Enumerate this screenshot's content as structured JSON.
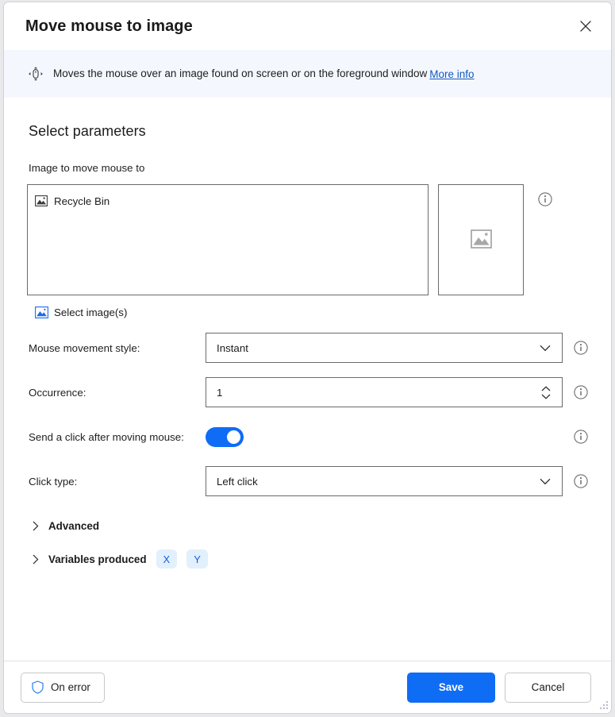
{
  "window": {
    "title": "Move mouse to image",
    "close_icon": "close-icon"
  },
  "banner": {
    "icon": "move-mouse-icon",
    "text": "Moves the mouse over an image found on screen or on the foreground window",
    "link_label": "More info"
  },
  "main": {
    "section_title": "Select parameters",
    "image_field": {
      "label": "Image to move mouse to",
      "items": [
        {
          "icon": "image-icon",
          "label": "Recycle Bin"
        }
      ],
      "thumbnail_placeholder_icon": "image-placeholder-icon",
      "info_icon": "info-icon",
      "select_link": {
        "icon": "image-icon-blue",
        "label": "Select image(s)"
      }
    },
    "params": [
      {
        "label": "Mouse movement style:",
        "type": "dropdown",
        "value": "Instant",
        "info_icon": "info-icon",
        "chevron_icon": "chevron-down-icon"
      },
      {
        "label": "Occurrence:",
        "type": "number",
        "value": "1",
        "info_icon": "info-icon",
        "spinner_icon": "spinner-arrows-icon"
      },
      {
        "label": "Send a click after moving mouse:",
        "type": "toggle",
        "value": "on",
        "info_icon": "info-icon"
      },
      {
        "label": "Click type:",
        "type": "dropdown",
        "value": "Left click",
        "info_icon": "info-icon",
        "chevron_icon": "chevron-down-icon"
      }
    ],
    "collapsibles": [
      {
        "label": "Advanced",
        "caret_icon": "chevron-right-icon",
        "chips": []
      },
      {
        "label": "Variables produced",
        "caret_icon": "chevron-right-icon",
        "chips": [
          "X",
          "Y"
        ]
      }
    ]
  },
  "footer": {
    "on_error_label": "On error",
    "on_error_icon": "shield-icon",
    "save_label": "Save",
    "cancel_label": "Cancel",
    "resize_grip_icon": "resize-grip-icon"
  },
  "colors": {
    "accent": "#0f6cf5",
    "link": "#1257c2",
    "banner_bg": "#f4f8fe",
    "chip_bg": "#e2effd",
    "chip_text": "#1661d8"
  }
}
